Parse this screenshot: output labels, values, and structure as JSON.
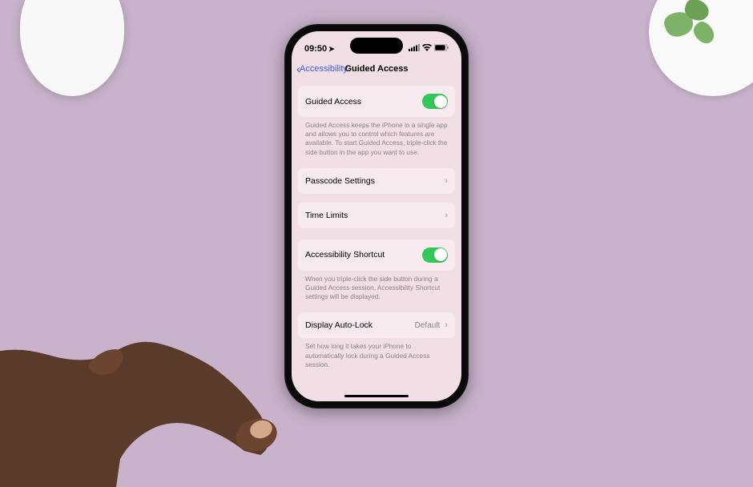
{
  "status": {
    "time": "09:50",
    "location_icon": "➤"
  },
  "nav": {
    "back_label": "Accessibility",
    "title": "Guided Access"
  },
  "rows": {
    "guided_access": {
      "label": "Guided Access",
      "footer": "Guided Access keeps the iPhone in a single app and allows you to control which features are available. To start Guided Access, triple-click the side button in the app you want to use."
    },
    "passcode": {
      "label": "Passcode Settings"
    },
    "time_limits": {
      "label": "Time Limits"
    },
    "shortcut": {
      "label": "Accessibility Shortcut",
      "footer": "When you triple-click the side button during a Guided Access session, Accessibility Shortcut settings will be displayed."
    },
    "autolock": {
      "label": "Display Auto-Lock",
      "value": "Default",
      "footer": "Set how long it takes your iPhone to automatically lock during a Guided Access session."
    }
  }
}
